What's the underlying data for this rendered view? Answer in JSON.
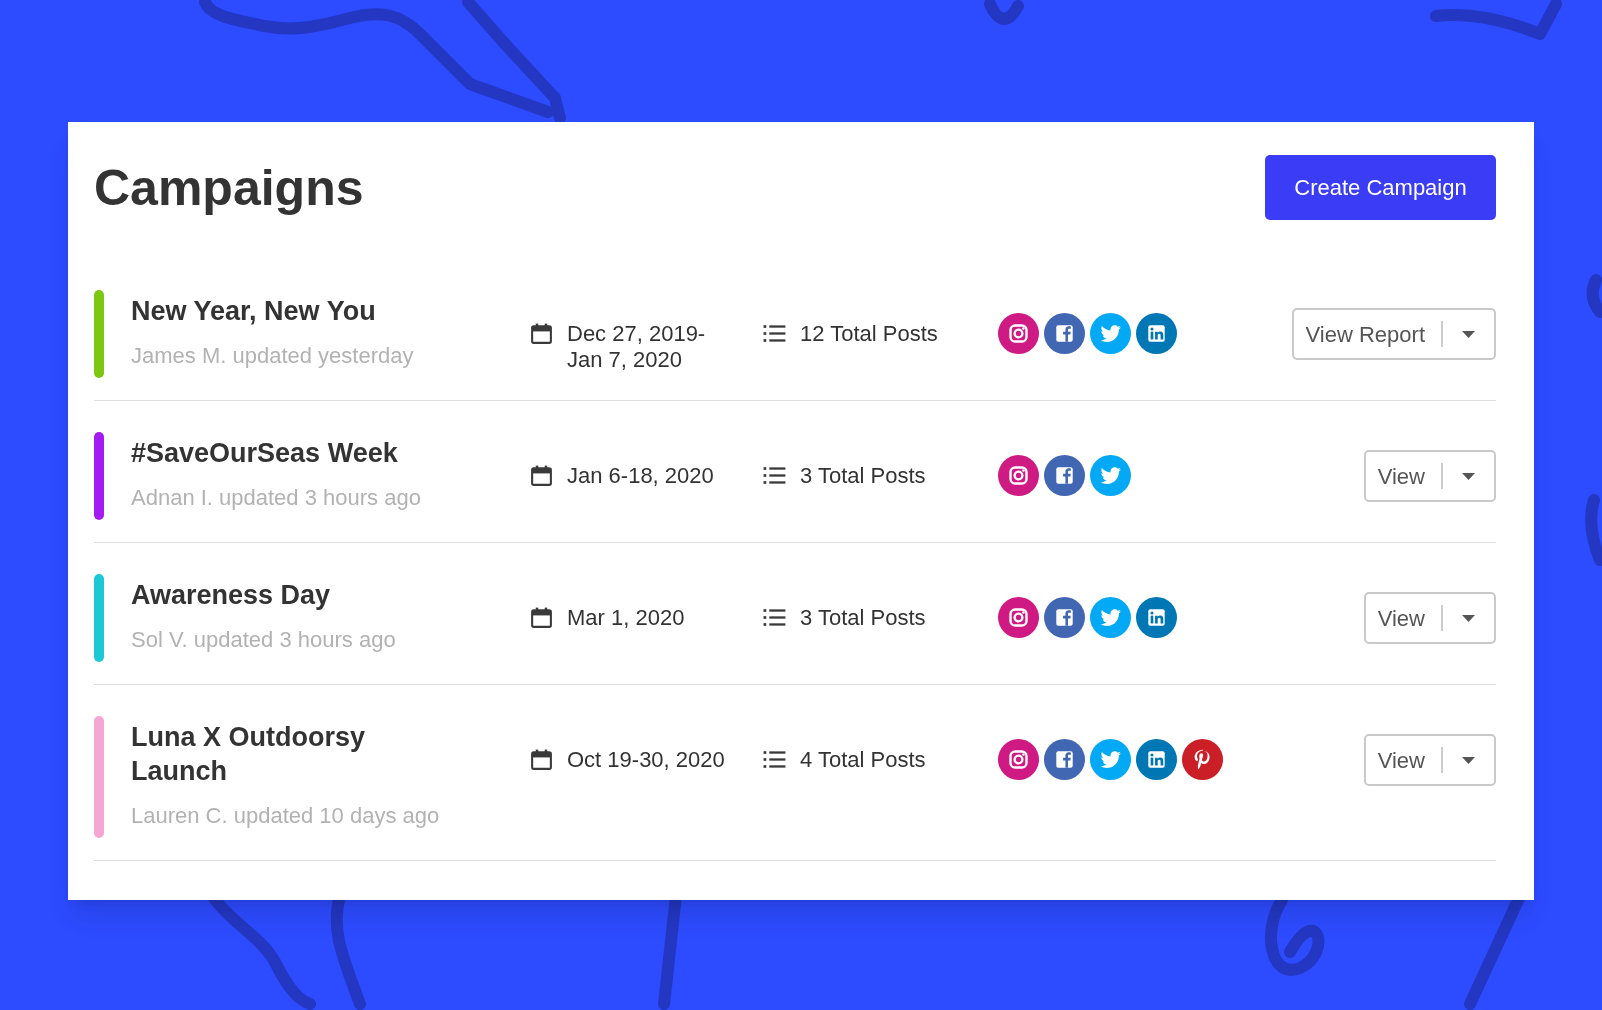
{
  "header": {
    "title": "Campaigns",
    "create_button": "Create Campaign"
  },
  "campaigns": [
    {
      "name": "New Year, New You",
      "color": "#7cc810",
      "updated": "James M. updated yesterday",
      "dates": "Dec 27, 2019-Jan 7, 2020",
      "posts": "12 Total Posts",
      "networks": [
        {
          "kind": "instagram"
        },
        {
          "kind": "facebook"
        },
        {
          "kind": "twitter"
        },
        {
          "kind": "linkedin"
        }
      ],
      "action": "View Report"
    },
    {
      "name": "#SaveOurSeas Week",
      "color": "#a31cf2",
      "updated": "Adnan I. updated 3 hours ago",
      "dates": "Jan 6-18, 2020",
      "posts": "3 Total Posts",
      "networks": [
        {
          "kind": "instagram"
        },
        {
          "kind": "facebook"
        },
        {
          "kind": "twitter"
        }
      ],
      "action": "View"
    },
    {
      "name": "Awareness Day",
      "color": "#1cc8d3",
      "updated": "Sol V. updated 3 hours ago",
      "dates": "Mar 1, 2020",
      "posts": "3 Total Posts",
      "networks": [
        {
          "kind": "instagram"
        },
        {
          "kind": "facebook"
        },
        {
          "kind": "twitter"
        },
        {
          "kind": "linkedin"
        }
      ],
      "action": "View"
    },
    {
      "name": "Luna X Outdoorsy Launch",
      "color": "#f5a6d5",
      "updated": "Lauren C. updated 10 days ago",
      "dates": "Oct 19-30, 2020",
      "posts": "4 Total Posts",
      "networks": [
        {
          "kind": "instagram"
        },
        {
          "kind": "facebook"
        },
        {
          "kind": "twitter"
        },
        {
          "kind": "linkedin"
        },
        {
          "kind": "pinterest"
        }
      ],
      "action": "View"
    }
  ]
}
